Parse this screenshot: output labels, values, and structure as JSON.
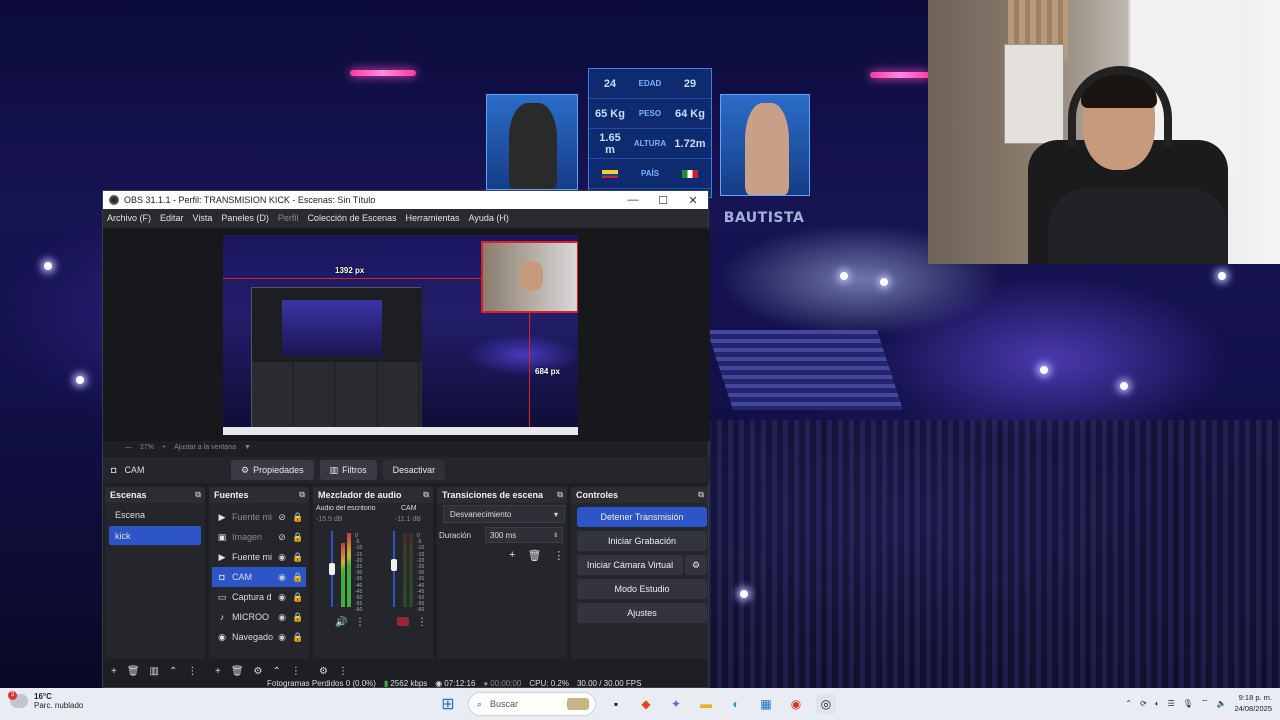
{
  "background": {
    "stats": [
      {
        "left": "24",
        "key": "EDAD",
        "right": "29"
      },
      {
        "left": "65 Kg",
        "key": "PESO",
        "right": "64 Kg"
      },
      {
        "left": "1.65 m",
        "key": "ALTURA",
        "right": "1.72m"
      },
      {
        "left": "",
        "key": "PAÍS",
        "right": ""
      }
    ],
    "fighter_name": "BAUTISTA"
  },
  "obs": {
    "title": "OBS 31.1.1 - Perfil: TRANSMISION KICK - Escenas: Sin Título",
    "window_controls": {
      "minimize": "—",
      "maximize": "☐",
      "close": "✕"
    },
    "menu": [
      "Archivo (F)",
      "Editar",
      "Vista",
      "Paneles (D)",
      "Perfil",
      "Colección de Escenas",
      "Herramientas",
      "Ayuda (H)"
    ],
    "preview": {
      "width_label": "1392 px",
      "height_label": "684 px"
    },
    "zoom": {
      "percent": "27%",
      "mode": "Ajustar a la ventana"
    },
    "source_bar": {
      "selected": "CAM",
      "properties": "Propiedades",
      "filters": "Filtros",
      "deactivate": "Desactivar"
    },
    "scenes": {
      "title": "Escenas",
      "items": [
        "Escena",
        "kick"
      ]
    },
    "sources": {
      "title": "Fuentes",
      "items": [
        {
          "name": "Fuente mi",
          "icon": "▶"
        },
        {
          "name": "Imagen",
          "icon": "▣"
        },
        {
          "name": "Fuente mi",
          "icon": "▶"
        },
        {
          "name": "CAM",
          "icon": "◘"
        },
        {
          "name": "Captura d",
          "icon": "▭"
        },
        {
          "name": "MICROO",
          "icon": "♪"
        },
        {
          "name": "Navegado",
          "icon": "◉"
        }
      ]
    },
    "mixer": {
      "title": "Mezclador de audio",
      "channels": [
        {
          "name": "Audio del escritorio",
          "db": "-15.9 dB"
        },
        {
          "name": "CAM",
          "db": "-11.1 dB"
        }
      ],
      "ticks": [
        "0",
        "-5",
        "-10",
        "-15",
        "-20",
        "-25",
        "-30",
        "-35",
        "-40",
        "-45",
        "-50",
        "-55",
        "-60"
      ]
    },
    "transitions": {
      "title": "Transiciones de escena",
      "selected": "Desvanecimiento",
      "duration_label": "Duración",
      "duration": "300 ms"
    },
    "controls": {
      "title": "Controles",
      "stop_stream": "Detener Transmisión",
      "start_recording": "Iniciar Grabación",
      "virtual_cam": "Iniciar Cámara Virtual",
      "studio_mode": "Modo Estudio",
      "settings": "Ajustes"
    },
    "status": {
      "dropped": "Fotogramas Perdidos 0 (0.0%)",
      "bitrate": "2562 kbps",
      "stream_time": "07:12:16",
      "rec_time": "00:00:00",
      "cpu": "CPU: 0.2%",
      "fps": "30.00 / 30.00 FPS"
    }
  },
  "taskbar": {
    "weather_temp": "16°C",
    "weather_desc": "Parc. nublado",
    "notification_count": "3",
    "search_placeholder": "Buscar",
    "time": "9:18 p. m.",
    "date": "24/08/2025"
  },
  "colors": {
    "accent": "#2d55c7",
    "selection_red": "#e02020",
    "laser": "#ff3a9a"
  }
}
